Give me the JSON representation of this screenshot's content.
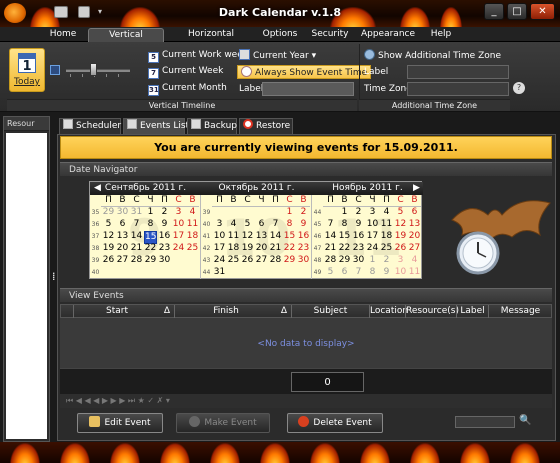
{
  "window": {
    "title": "Dark Calendar v.1.8",
    "buttons": [
      "_",
      "□",
      "✕"
    ]
  },
  "menu": {
    "tabs": [
      "Home",
      "Vertical Timeline",
      "Horizontal Timeline",
      "Options",
      "Security",
      "Appearance",
      "Help"
    ],
    "active": "Vertical Timeline"
  },
  "ribbon": {
    "today_label": "Today",
    "today_number": "1",
    "current_work_week": "Current Work week",
    "current_week": "Current Week",
    "current_month": "Current Month",
    "current_year": "Current Year",
    "current_year_arrow": "▾",
    "always_show_event_time": "Always Show Event Time",
    "label": "Label",
    "group_vertical_timeline": "Vertical Timeline",
    "show_additional_time_zone": "Show Additional Time Zone",
    "tz_label": "Label",
    "tz_time_zone": "Time Zone",
    "group_additional_time_zone": "Additional Time Zone",
    "work_week_icon": "5",
    "week_icon": "7",
    "month_icon": "31"
  },
  "left_panel": {
    "header": "Resour"
  },
  "subtabs": [
    "Scheduler",
    "Events List",
    "Backup",
    "Restore"
  ],
  "subtab_active": "Events List",
  "banner": "You are currently viewing events for 15.09.2011.",
  "date_navigator": {
    "header": "Date Navigator",
    "months": [
      {
        "title": "Сентябрь 2011 г.",
        "watermark": "9",
        "dow": [
          "П",
          "В",
          "С",
          "Ч",
          "П",
          "С",
          "В"
        ],
        "weeks": [
          "35",
          "36",
          "37",
          "38",
          "39",
          "40"
        ],
        "rows": [
          [
            "29",
            "30",
            "31",
            "1",
            "2",
            "3",
            "4"
          ],
          [
            "5",
            "6",
            "7",
            "8",
            "9",
            "10",
            "11"
          ],
          [
            "12",
            "13",
            "14",
            "15",
            "16",
            "17",
            "18"
          ],
          [
            "19",
            "20",
            "21",
            "22",
            "23",
            "24",
            "25"
          ],
          [
            "26",
            "27",
            "28",
            "29",
            "30",
            "",
            " "
          ],
          [
            "",
            "",
            "",
            "",
            "",
            "",
            ""
          ]
        ]
      },
      {
        "title": "Октябрь 2011 г.",
        "watermark": "10",
        "dow": [
          "П",
          "В",
          "С",
          "Ч",
          "П",
          "С",
          "В"
        ],
        "weeks": [
          "39",
          "40",
          "41",
          "42",
          "43",
          "44"
        ],
        "rows": [
          [
            "",
            "",
            "",
            "",
            "",
            "1",
            "2"
          ],
          [
            "3",
            "4",
            "5",
            "6",
            "7",
            "8",
            "9"
          ],
          [
            "10",
            "11",
            "12",
            "13",
            "14",
            "15",
            "16"
          ],
          [
            "17",
            "18",
            "19",
            "20",
            "21",
            "22",
            "23"
          ],
          [
            "24",
            "25",
            "26",
            "27",
            "28",
            "29",
            "30"
          ],
          [
            "31",
            "",
            "",
            "",
            "",
            "",
            ""
          ]
        ]
      },
      {
        "title": "Ноябрь 2011 г.",
        "watermark": "11",
        "dow": [
          "П",
          "В",
          "С",
          "Ч",
          "П",
          "С",
          "В"
        ],
        "weeks": [
          "44",
          "45",
          "46",
          "47",
          "48",
          "49"
        ],
        "rows": [
          [
            "",
            "1",
            "2",
            "3",
            "4",
            "5",
            "6"
          ],
          [
            "7",
            "8",
            "9",
            "10",
            "11",
            "12",
            "13"
          ],
          [
            "14",
            "15",
            "16",
            "17",
            "18",
            "19",
            "20"
          ],
          [
            "21",
            "22",
            "23",
            "24",
            "25",
            "26",
            "27"
          ],
          [
            "28",
            "29",
            "30",
            "1",
            "2",
            "3",
            "4"
          ],
          [
            "5",
            "6",
            "7",
            "8",
            "9",
            "10",
            "11"
          ]
        ]
      }
    ],
    "selected_date": "15",
    "prev_arrow": "◀",
    "next_arrow": "▶"
  },
  "view_events": {
    "header": "View Events",
    "columns": [
      "Start",
      "Finish",
      "Subject",
      "Location",
      "Resource(s)",
      "Label",
      "Message"
    ],
    "sort_marks": [
      "Δ",
      "Δ"
    ],
    "empty_text": "<No data to display>",
    "count": "0"
  },
  "navigator_bar": "⏮ ◀ ◀ ◀ ▶ ▶ ▶ ⏭ ★ ✓ ✗ ▾",
  "buttons": {
    "edit_event": "Edit Event",
    "make_event": "Make Event",
    "delete_event": "Delete Event"
  },
  "colors": {
    "accent_yellow": "#f7c44a",
    "selected_day": "#2a56c6",
    "weekend_red": "#d01818"
  }
}
